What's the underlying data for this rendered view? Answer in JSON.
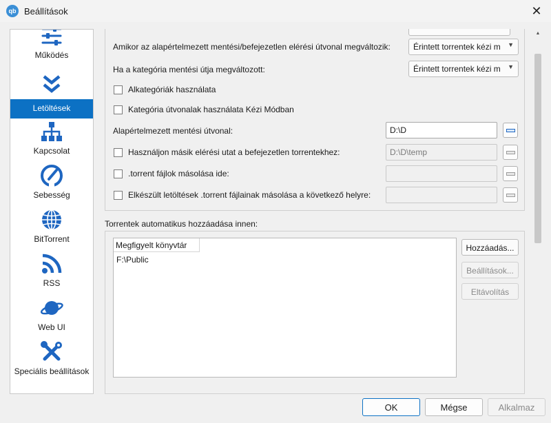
{
  "window": {
    "title": "Beállítások",
    "app_icon_text": "qb"
  },
  "sidebar": {
    "items": [
      {
        "label": "Működés",
        "icon": "sliders-icon"
      },
      {
        "label": "Letöltések",
        "icon": "double-chevron-down-icon",
        "selected": true
      },
      {
        "label": "Kapcsolat",
        "icon": "network-icon"
      },
      {
        "label": "Sebesség",
        "icon": "speedometer-icon"
      },
      {
        "label": "BitTorrent",
        "icon": "globe-icon"
      },
      {
        "label": "RSS",
        "icon": "rss-icon"
      },
      {
        "label": "Web UI",
        "icon": "planet-icon"
      },
      {
        "label": "Speciális beállítások",
        "icon": "tools-icon"
      }
    ]
  },
  "downloads": {
    "default_path_changed_label": "Amikor az alapértelmezett mentési/befejezetlen elérési útvonal megváltozik:",
    "default_path_changed_value": "Érintett torrentek kézi m",
    "category_path_changed_label": "Ha a kategória mentési útja megváltozott:",
    "category_path_changed_value": "Érintett torrentek kézi m",
    "use_subcategories": "Alkategóriák használata",
    "use_category_paths_manual": "Kategória útvonalak használata Kézi Módban",
    "default_save_path_label": "Alapértelmezett mentési útvonal:",
    "default_save_path_value": "D:\\D",
    "incomplete_path_label": "Használjon másik elérési utat a befejezetlen torrentekhez:",
    "incomplete_path_value": "D:\\D\\temp",
    "copy_torrent_files_label": ".torrent fájlok másolása ide:",
    "copy_torrent_files_value": "",
    "copy_finished_torrent_files_label": "Elkészült letöltések .torrent fájlainak másolása a következő helyre:",
    "copy_finished_torrent_files_value": ""
  },
  "auto_add": {
    "title": "Torrentek automatikus hozzáadása innen:",
    "column_header": "Megfigyelt könyvtár",
    "rows": [
      "F:\\Public"
    ],
    "add_button": "Hozzáadás...",
    "options_button": "Beállítások...",
    "remove_button": "Eltávolítás"
  },
  "footer": {
    "ok": "OK",
    "cancel": "Mégse",
    "apply": "Alkalmaz"
  },
  "colors": {
    "accent": "#0c71c4",
    "icon_blue": "#1e66c1"
  }
}
